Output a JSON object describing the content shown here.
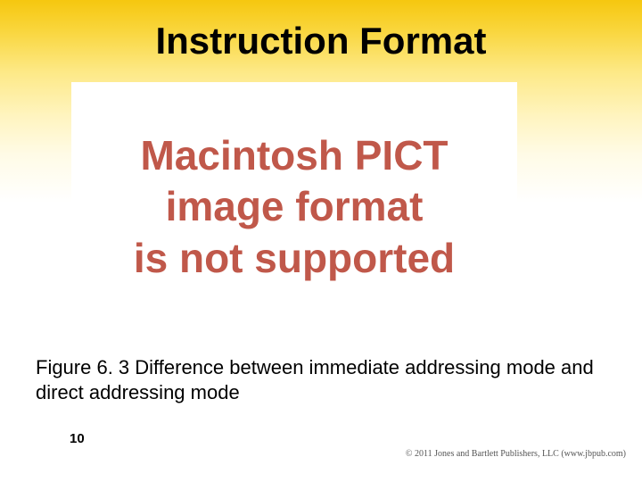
{
  "slide": {
    "title": "Instruction Format",
    "pict_placeholder": {
      "line1": "Macintosh PICT",
      "line2": "image format",
      "line3": "is not supported"
    },
    "caption": "Figure 6. 3 Difference between immediate addressing mode and direct addressing mode",
    "page_number": "10",
    "copyright": "© 2011 Jones and Bartlett Publishers, LLC (www.jbpub.com)"
  }
}
